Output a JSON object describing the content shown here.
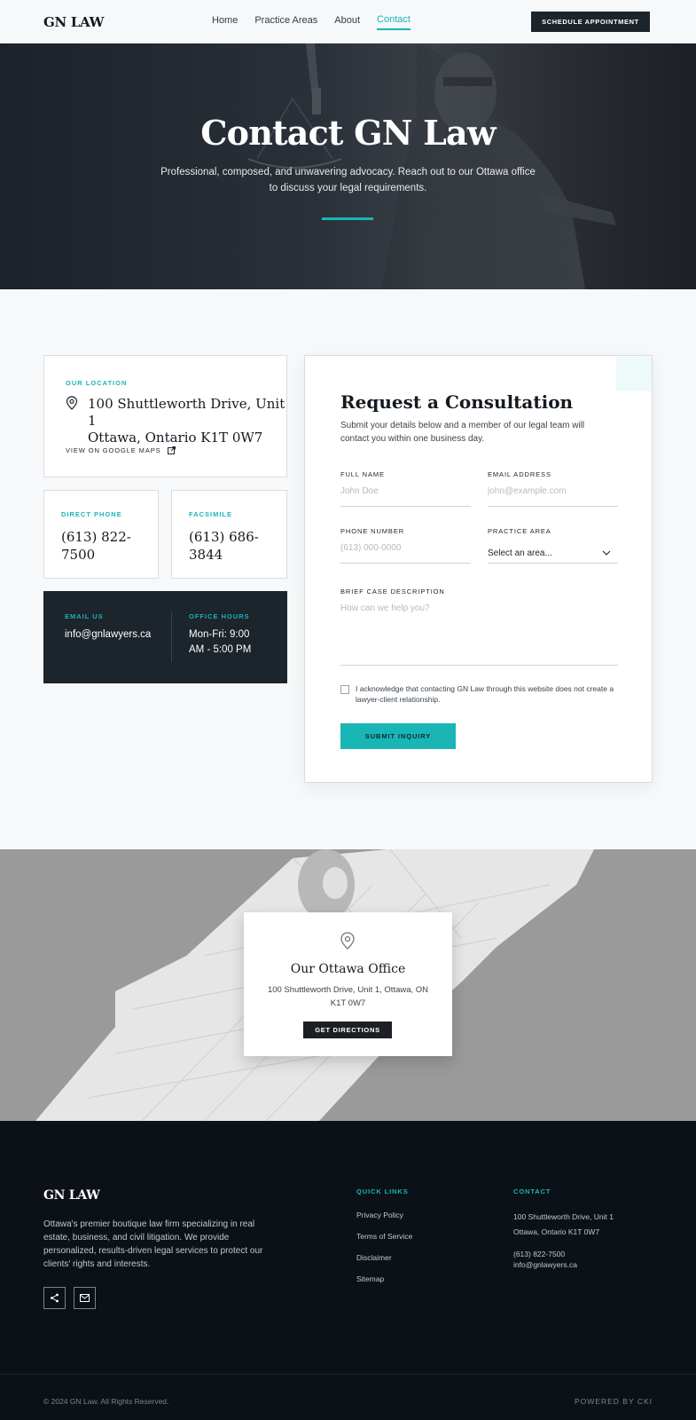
{
  "nav": {
    "logo": "GN LAW",
    "links": [
      "Home",
      "Practice Areas",
      "About",
      "Contact"
    ],
    "active": "Contact",
    "cta": "SCHEDULE APPOINTMENT"
  },
  "hero": {
    "title": "Contact GN Law",
    "subtitle": "Professional, composed, and unwavering advocacy. Reach out to our Ottawa office to discuss your legal requirements."
  },
  "location": {
    "eyebrow": "OUR LOCATION",
    "address_line1": "100 Shuttleworth Drive, Unit 1",
    "address_line2": "Ottawa, Ontario K1T 0W7",
    "maps_link": "VIEW ON GOOGLE MAPS"
  },
  "phone": {
    "eyebrow": "DIRECT PHONE",
    "value": "(613) 822-7500"
  },
  "fax": {
    "eyebrow": "FACSIMILE",
    "value": "(613) 686-3844"
  },
  "email": {
    "eyebrow": "EMAIL US",
    "value": "info@gnlawyers.ca"
  },
  "hours": {
    "eyebrow": "OFFICE HOURS",
    "line1": "Mon-Fri: 9:00",
    "line2": "AM - 5:00 PM"
  },
  "form": {
    "title": "Request a Consultation",
    "subtitle": "Submit your details below and a member of our legal team will contact you within one business day.",
    "full_name_label": "FULL NAME",
    "full_name_placeholder": "John Doe",
    "email_label": "EMAIL ADDRESS",
    "email_placeholder": "john@example.com",
    "phone_label": "PHONE NUMBER",
    "phone_placeholder": "(613) 000-0000",
    "area_label": "PRACTICE AREA",
    "area_value": "Select an area...",
    "desc_label": "BRIEF CASE DESCRIPTION",
    "desc_placeholder": "How can we help you?",
    "ack": "I acknowledge that contacting GN Law through this website does not create a lawyer-client relationship.",
    "submit": "SUBMIT INQUIRY"
  },
  "office": {
    "title": "Our Ottawa Office",
    "address": "100 Shuttleworth Drive, Unit 1, Ottawa, ON K1T 0W7",
    "button": "GET DIRECTIONS"
  },
  "footer": {
    "logo": "GN LAW",
    "about": "Ottawa's premier boutique law firm specializing in real estate, business, and civil litigation. We provide personalized, results-driven legal services to protect our clients' rights and interests.",
    "quick_links_title": "QUICK LINKS",
    "quick_links": [
      "Privacy Policy",
      "Terms of Service",
      "Disclaimer",
      "Sitemap"
    ],
    "contact_title": "CONTACT",
    "contact_address1": "100 Shuttleworth Drive, Unit 1",
    "contact_address2": "Ottawa, Ontario K1T 0W7",
    "contact_phone": "(613) 822-7500",
    "contact_email": "info@gnlawyers.ca",
    "copyright": "© 2024 GN Law. All Rights Reserved.",
    "powered": "POWERED BY CKI"
  },
  "colors": {
    "accent": "#1ab5b5",
    "dark": "#1c242c",
    "footer_bg": "#0b1117"
  },
  "icons": [
    "map-pin-icon",
    "external-link-icon",
    "chevron-down-icon",
    "share-icon",
    "mail-icon"
  ]
}
